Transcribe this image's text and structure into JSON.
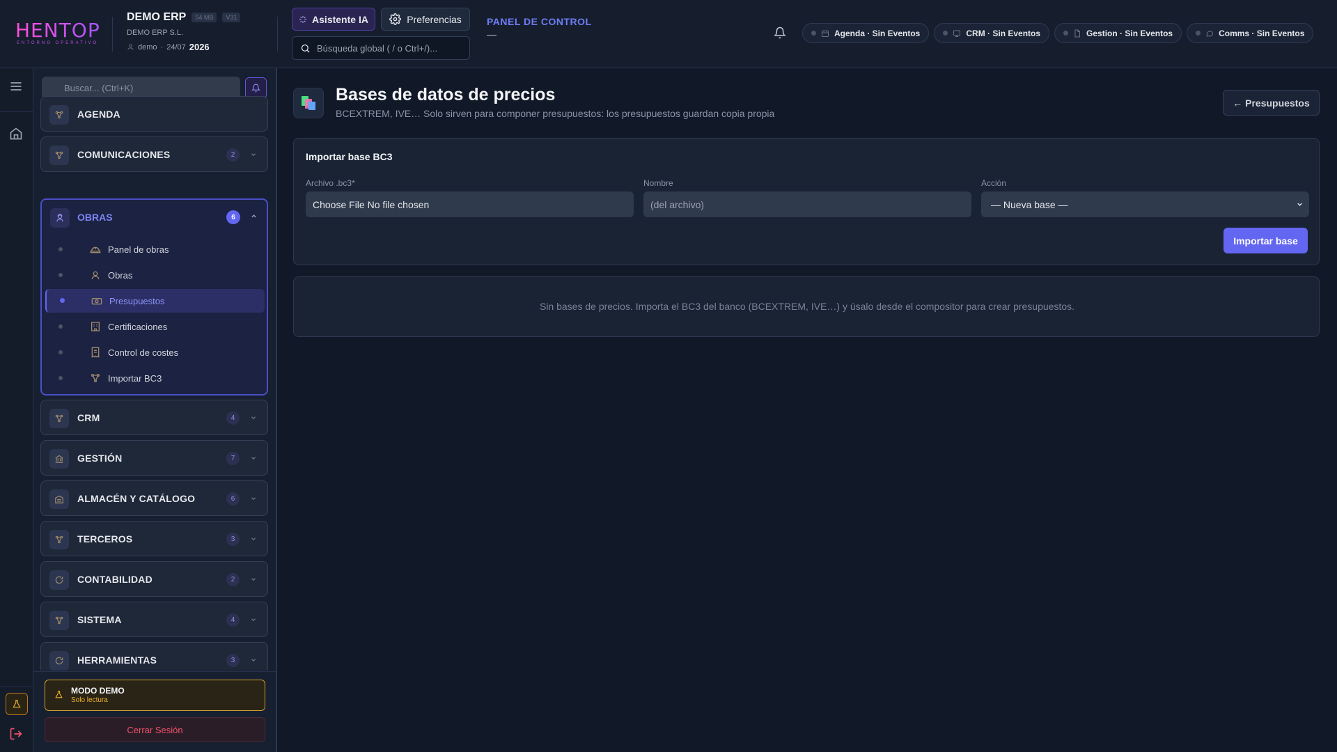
{
  "header": {
    "logo_text": "HENTOP",
    "logo_sub": "ENTORNO OPERATIVO",
    "company_name": "DEMO ERP",
    "chip_size": "54 MB",
    "chip_version": "V31",
    "company_legal": "DEMO ERP S.L.",
    "user": "demo",
    "date": "24/07",
    "year": "2026",
    "ai_button": "Asistente IA",
    "prefs_button": "Preferencias",
    "search_placeholder": "Búsqueda global ( / o Ctrl+/)...",
    "panel_title": "PANEL DE CONTROL",
    "panel_dash": "—",
    "pills": [
      {
        "label": "Agenda · Sin Eventos",
        "icon": "calendar-icon"
      },
      {
        "label": "CRM · Sin Eventos",
        "icon": "monitor-icon"
      },
      {
        "label": "Gestion · Sin Eventos",
        "icon": "document-icon"
      },
      {
        "label": "Comms · Sin Eventos",
        "icon": "chat-icon"
      }
    ]
  },
  "sidebar": {
    "search_placeholder": "Buscar... (Ctrl+K)",
    "sections": [
      {
        "label": "AGENDA",
        "badge": null
      },
      {
        "label": "COMUNICACIONES",
        "badge": "2"
      },
      {
        "label": "OBRAS",
        "badge": "6",
        "open": true
      },
      {
        "label": "CRM",
        "badge": "4"
      },
      {
        "label": "GESTIÓN",
        "badge": "7"
      },
      {
        "label": "ALMACÉN Y CATÁLOGO",
        "badge": "6"
      },
      {
        "label": "TERCEROS",
        "badge": "3"
      },
      {
        "label": "CONTABILIDAD",
        "badge": "2"
      },
      {
        "label": "SISTEMA",
        "badge": "4"
      },
      {
        "label": "HERRAMIENTAS",
        "badge": "3"
      }
    ],
    "obras_items": [
      {
        "label": "Panel de obras",
        "active": false
      },
      {
        "label": "Obras",
        "active": false
      },
      {
        "label": "Presupuestos",
        "active": true
      },
      {
        "label": "Certificaciones",
        "active": false
      },
      {
        "label": "Control de costes",
        "active": false
      },
      {
        "label": "Importar BC3",
        "active": false
      }
    ],
    "demo_title": "MODO DEMO",
    "demo_sub": "Solo lectura",
    "logout": "Cerrar Sesión"
  },
  "main": {
    "title": "Bases de datos de precios",
    "subtitle": "BCEXTREM, IVE… Solo sirven para componer presupuestos: los presupuestos guardan copia propia",
    "back_button": "← Presupuestos",
    "import_card": {
      "title": "Importar base BC3",
      "file_label": "Archivo .bc3*",
      "file_value": "Choose File No file chosen",
      "name_label": "Nombre",
      "name_placeholder": "(del archivo)",
      "action_label": "Acción",
      "action_value": "— Nueva base —",
      "import_button": "Importar base"
    },
    "empty_message": "Sin bases de precios. Importa el BC3 del banco (BCEXTREM, IVE…) y úsalo desde el compositor para crear presupuestos."
  },
  "colors": {
    "accent": "#6366f1",
    "background": "#111827",
    "panel": "#1a2334",
    "demo_accent": "#d69e2e",
    "logout_text": "#f0526b",
    "logo": "#e040d0"
  }
}
